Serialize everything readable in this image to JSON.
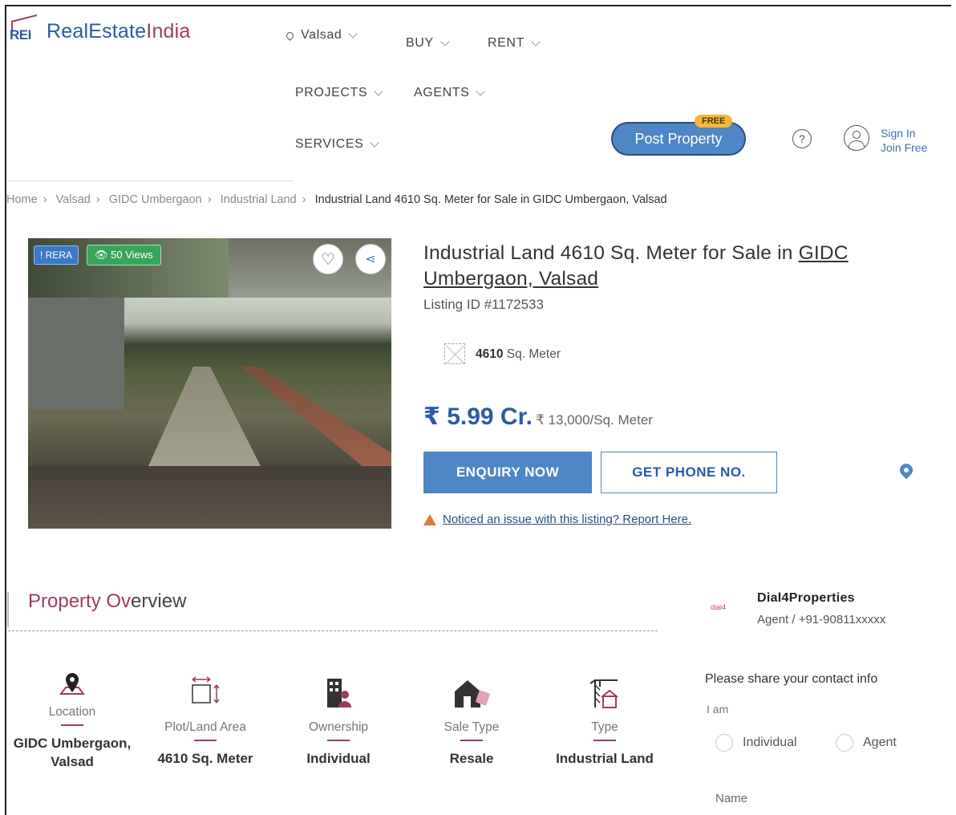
{
  "header": {
    "logo_mark": "REI",
    "logo_name_1": "RealEstate",
    "logo_name_2": "India",
    "city": "Valsad",
    "nav": [
      "BUY",
      "RENT",
      "PROJECTS",
      "AGENTS",
      "SERVICES"
    ],
    "post_property": "Post Property",
    "free_badge": "FREE",
    "help": "?",
    "sign_in": "Sign In",
    "join_free": "Join Free"
  },
  "breadcrumb": {
    "items": [
      "Home",
      "Valsad",
      "GIDC Umbergaon",
      "Industrial Land"
    ],
    "current": "Industrial Land 4610 Sq. Meter for Sale in GIDC Umbergaon, Valsad",
    "separator": "›"
  },
  "photo": {
    "rera_badge": "! RERA",
    "views_badge": "50 Views"
  },
  "listing": {
    "title_plain": "Industrial Land 4610 Sq. Meter for Sale in ",
    "title_link": "GIDC Umbergaon, Valsad",
    "listing_id": "Listing ID #1172533",
    "area_value": "4610",
    "area_unit": "Sq. Meter",
    "price": "₹ 5.99 Cr.",
    "price_per_unit": "₹ 13,000/Sq. Meter",
    "enquiry_button": "ENQUIRY NOW",
    "phone_button": "GET PHONE NO.",
    "report_text": "Noticed an issue with this listing? Report Here."
  },
  "overview": {
    "title_1": "Property Ov",
    "title_2": "erview",
    "items": [
      {
        "icon": "location-pin-icon",
        "label": "Location",
        "value": "GIDC Umbergaon, Valsad"
      },
      {
        "icon": "plot-area-icon",
        "label": "Plot/Land Area",
        "value": "4610 Sq. Meter"
      },
      {
        "icon": "ownership-icon",
        "label": "Ownership",
        "value": "Individual"
      },
      {
        "icon": "house-sale-icon",
        "label": "Sale Type",
        "value": "Resale"
      },
      {
        "icon": "crane-icon",
        "label": "Type",
        "value": "Industrial Land"
      }
    ]
  },
  "agent": {
    "logo_text": "dial4",
    "name": "Dial4Properties",
    "subtitle": "Agent / +91-90811xxxxx"
  },
  "contact_form": {
    "heading": "Please share your contact info",
    "i_am": "I am",
    "options": [
      "Individual",
      "Agent"
    ],
    "name_label": "Name"
  },
  "colors": {
    "brand_blue": "#2b5aa5",
    "brand_maroon": "#a23b5a",
    "button_blue": "#4f86c6"
  }
}
